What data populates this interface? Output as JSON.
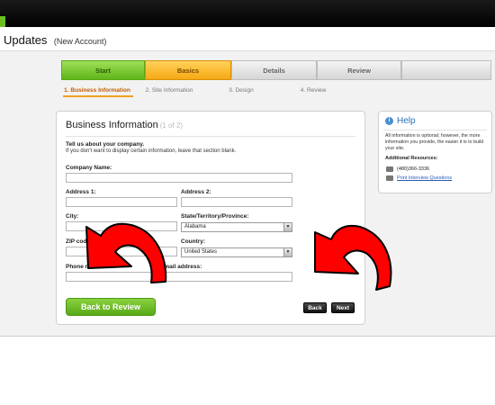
{
  "page": {
    "title": "Updates",
    "subtitle": "(New Account)"
  },
  "wizard": {
    "steps": [
      {
        "label": "Start",
        "state": "done"
      },
      {
        "label": "Basics",
        "state": "active"
      },
      {
        "label": "Details",
        "state": "inactive"
      },
      {
        "label": "Review",
        "state": "inactive"
      },
      {
        "label": "",
        "state": "inactive"
      }
    ],
    "substeps": [
      {
        "label": "1. Business Information",
        "active": true
      },
      {
        "label": "2. Site Information",
        "active": false
      },
      {
        "label": "3. Design",
        "active": false
      },
      {
        "label": "4. Review",
        "active": false
      }
    ]
  },
  "form": {
    "title": "Business Information",
    "step_count": "(1 of 2)",
    "intro_strong": "Tell us about your company.",
    "intro_text": "If you don't want to display certain information, leave that section blank.",
    "company_name_label": "Company Name:",
    "address1_label": "Address 1:",
    "address2_label": "Address 2:",
    "city_label": "City:",
    "state_label": "State/Territory/Province:",
    "state_value": "Alabama",
    "zip_label": "ZIP code:",
    "country_label": "Country:",
    "country_value": "United States",
    "phone_label": "Phone number:",
    "email_label": "Email address:",
    "back_to_review": "Back to Review",
    "back": "Back",
    "next": "Next"
  },
  "help": {
    "title": "Help",
    "body": "All information is optional; however, the more information you provide, the easier it is to build your site.",
    "resources_heading": "Additional Resources:",
    "phone": "(480)366-3336",
    "print_link": "Print Interview Questions"
  },
  "colors": {
    "accent_green": "#6cc01e",
    "active_orange": "#f6a914",
    "annotation_red": "#ff0000",
    "help_blue": "#2f6fb5"
  }
}
